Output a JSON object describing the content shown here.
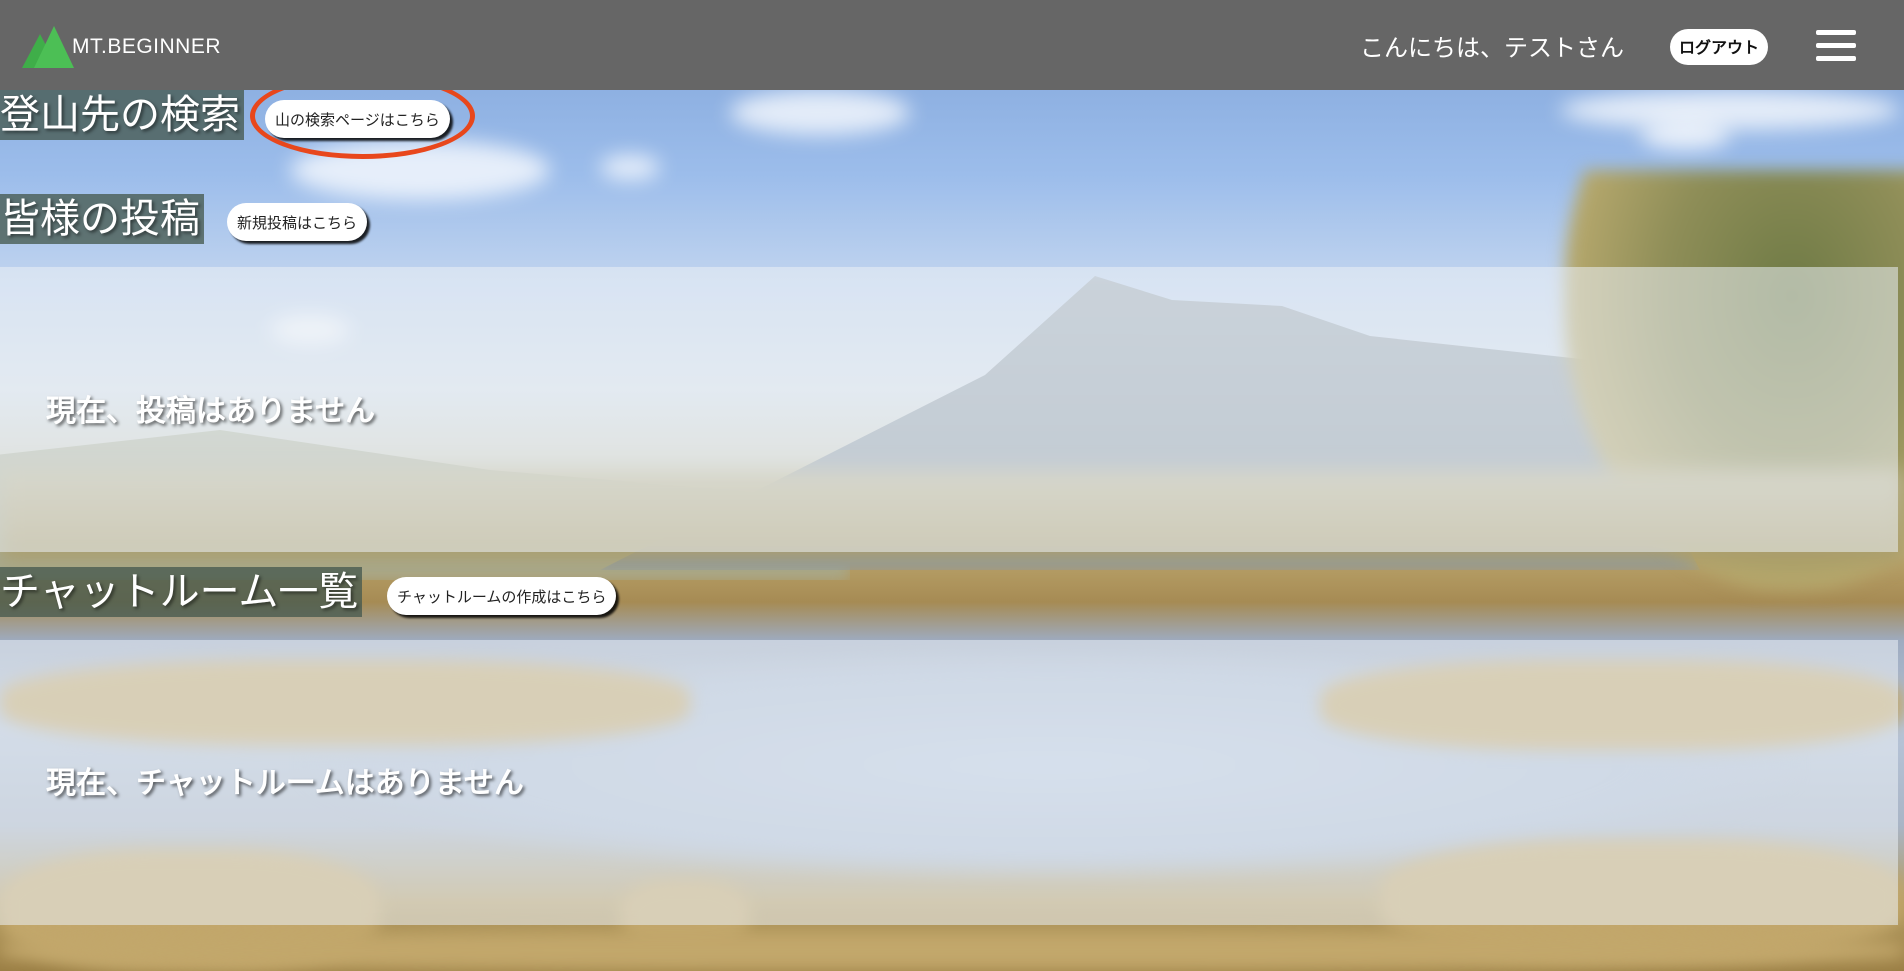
{
  "header": {
    "logo_text": "MT.BEGINNER",
    "greeting": "こんにちは、テストさん",
    "logout_label": "ログアウト",
    "bg_color": "#666666"
  },
  "sections": {
    "search": {
      "title": "登山先の検索",
      "button_label": "山の検索ページはこちら"
    },
    "posts": {
      "title": "皆様の投稿",
      "button_label": "新規投稿はこちら",
      "empty_message": "現在、投稿はありません"
    },
    "chatrooms": {
      "title": "チャットルーム一覧",
      "button_label": "チャットルームの作成はこちら",
      "empty_message": "現在、チャットルームはありません"
    }
  },
  "colors": {
    "logo_green": "#3fae49",
    "highlight_ring": "#e8471c"
  },
  "icons": {
    "logo": "mountain-logo-icon",
    "menu": "hamburger-menu-icon"
  }
}
